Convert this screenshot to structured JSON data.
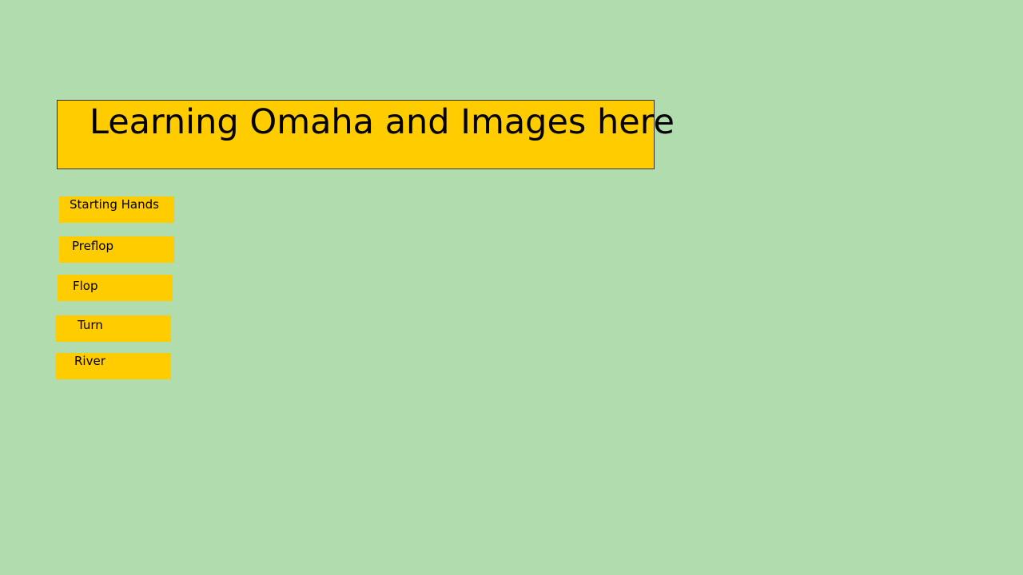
{
  "colors": {
    "background": "#b1dcae",
    "accent": "#ffcc00"
  },
  "slide": {
    "title": "Learning Omaha and Images here"
  },
  "nav": {
    "buttons": [
      {
        "label": "Starting Hands"
      },
      {
        "label": "Preflop"
      },
      {
        "label": "Flop"
      },
      {
        "label": "Turn"
      },
      {
        "label": "River"
      }
    ]
  }
}
